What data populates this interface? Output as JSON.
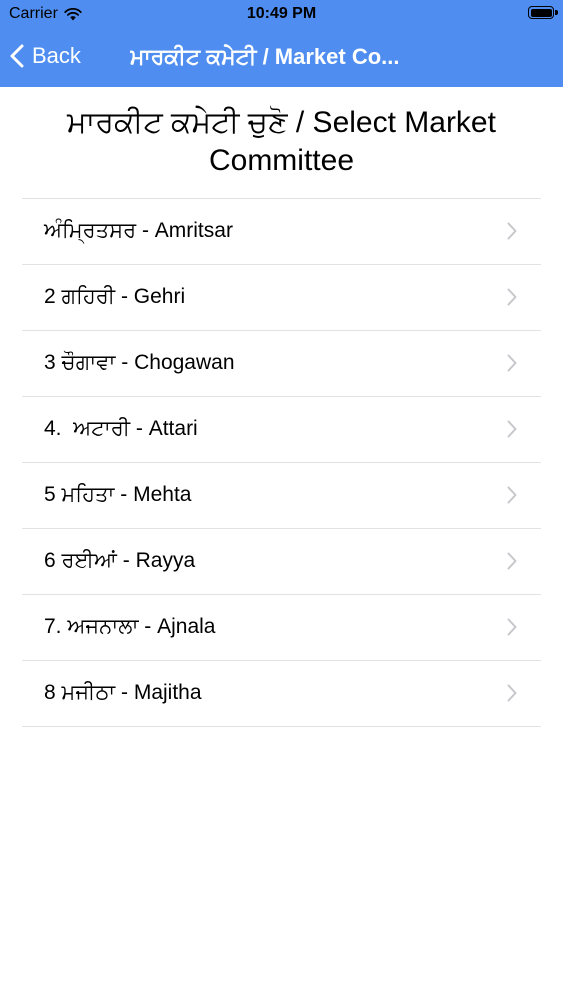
{
  "status_bar": {
    "carrier": "Carrier",
    "time": "10:49 PM"
  },
  "nav": {
    "back_label": "Back",
    "title": "ਮਾਰਕੀਟ ਕਮੇਟੀ / Market Co..."
  },
  "page": {
    "title": "ਮਾਰਕੀਟ ਕਮੇਟੀ ਚੁਣੋ / Select Market Committee"
  },
  "committees": [
    "ਅੰਮ੍ਰਿਤਸਰ - Amritsar",
    "2 ਗਹਿਰੀ - Gehri",
    "3 ਚੌਗਾਵਾ - Chogawan",
    "4.  ਅਟਾਰੀ - Attari",
    "5 ਮਹਿਤਾ - Mehta",
    "6 ਰਈਆਂ - Rayya",
    "7. ਅਜਨਾਲਾ - Ajnala",
    "8 ਮਜੀਠਾ - Majitha"
  ],
  "colors": {
    "nav_background": "#4f8ef0",
    "nav_text": "#ffffff",
    "separator": "#e2e2e6",
    "chevron": "#c7c7cc"
  },
  "icons": {
    "back": "chevron-left-icon",
    "row": "chevron-right-icon",
    "wifi": "wifi-icon",
    "battery": "battery-icon"
  }
}
